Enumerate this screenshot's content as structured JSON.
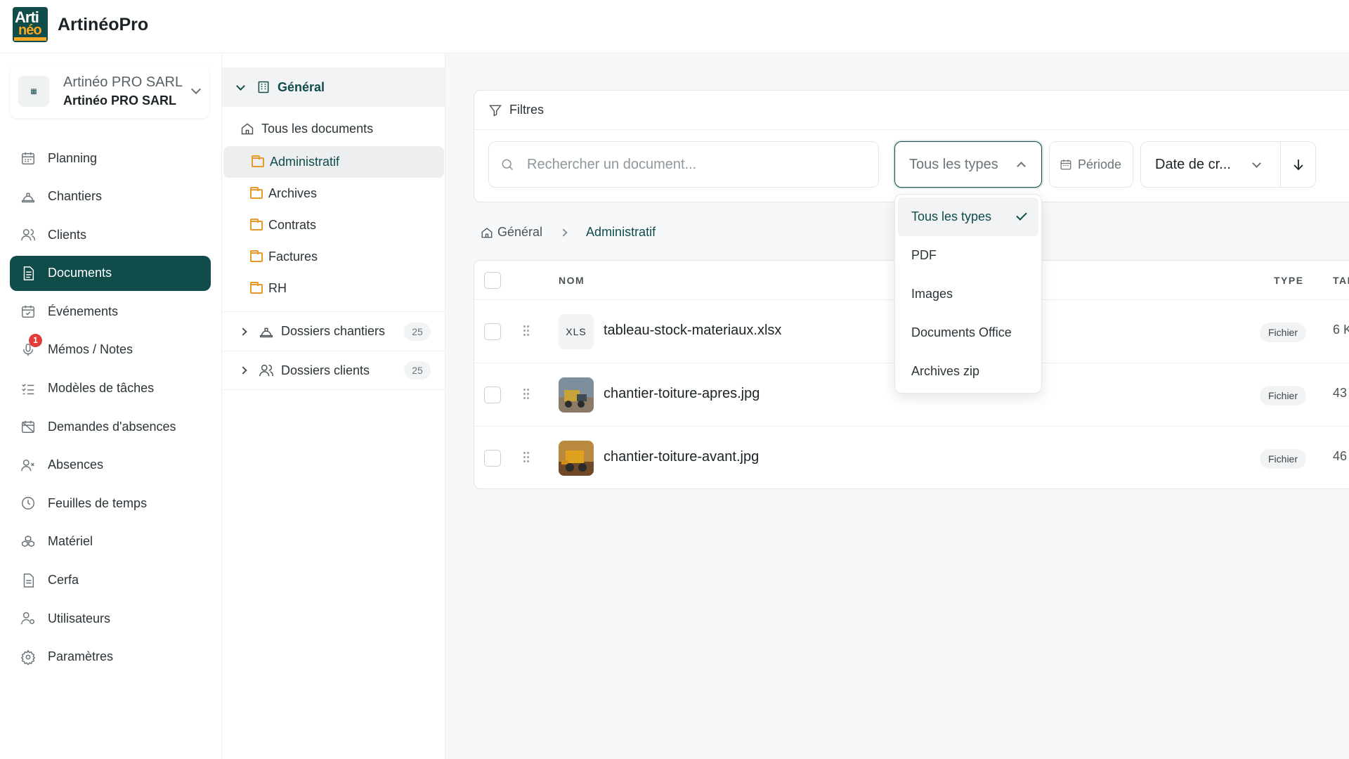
{
  "app": {
    "name": "ArtinéoPro",
    "logo_text_1": "Arti",
    "logo_text_2": "néo"
  },
  "company": {
    "name": "Artinéo PRO SARL",
    "subtitle": "Artinéo PRO SARL"
  },
  "sidebar": {
    "items": [
      {
        "label": "Planning",
        "icon": "calendar-icon"
      },
      {
        "label": "Chantiers",
        "icon": "helmet-icon"
      },
      {
        "label": "Clients",
        "icon": "users-icon"
      },
      {
        "label": "Documents",
        "icon": "document-icon",
        "active": true
      },
      {
        "label": "Événements",
        "icon": "calendar-check-icon"
      },
      {
        "label": "Mémos / Notes",
        "icon": "microphone-icon",
        "badge": "1"
      },
      {
        "label": "Modèles de tâches",
        "icon": "checklist-icon"
      },
      {
        "label": "Demandes d'absences",
        "icon": "calendar-off-icon"
      },
      {
        "label": "Absences",
        "icon": "user-x-icon"
      },
      {
        "label": "Feuilles de temps",
        "icon": "clock-icon"
      },
      {
        "label": "Matériel",
        "icon": "boxes-icon"
      },
      {
        "label": "Cerfa",
        "icon": "file-text-icon"
      },
      {
        "label": "Utilisateurs",
        "icon": "user-settings-icon"
      },
      {
        "label": "Paramètres",
        "icon": "gear-icon"
      }
    ]
  },
  "folders": {
    "header": "Général",
    "all_docs": "Tous les documents",
    "subfolders": [
      "Administratif",
      "Archives",
      "Contrats",
      "Factures",
      "RH"
    ],
    "selected": "Administratif",
    "groups": [
      {
        "label": "Dossiers chantiers",
        "count": "25"
      },
      {
        "label": "Dossiers clients",
        "count": "25"
      }
    ]
  },
  "filters": {
    "title": "Filtres",
    "search_placeholder": "Rechercher un document...",
    "type_value": "Tous les types",
    "period_label": "Période",
    "sort_value": "Date de cr..."
  },
  "breadcrumb": {
    "root": "Général",
    "current": "Administratif"
  },
  "table": {
    "columns": {
      "name": "NOM",
      "type": "TYPE",
      "size": "TAI"
    },
    "rows": [
      {
        "thumb": "XLS",
        "name": "tableau-stock-materiaux.xlsx",
        "type": "Fichier",
        "size": "6 K"
      },
      {
        "thumb": "image",
        "name": "chantier-toiture-apres.jpg",
        "type": "Fichier",
        "size": "43"
      },
      {
        "thumb": "image",
        "name": "chantier-toiture-avant.jpg",
        "type": "Fichier",
        "size": "46"
      }
    ]
  },
  "type_dropdown": {
    "options": [
      "Tous les types",
      "PDF",
      "Images",
      "Documents Office",
      "Archives zip"
    ],
    "selected": "Tous les types"
  },
  "colors": {
    "primary": "#0f4c4a",
    "accent": "#e59a2a",
    "badge": "#e23b3b"
  }
}
